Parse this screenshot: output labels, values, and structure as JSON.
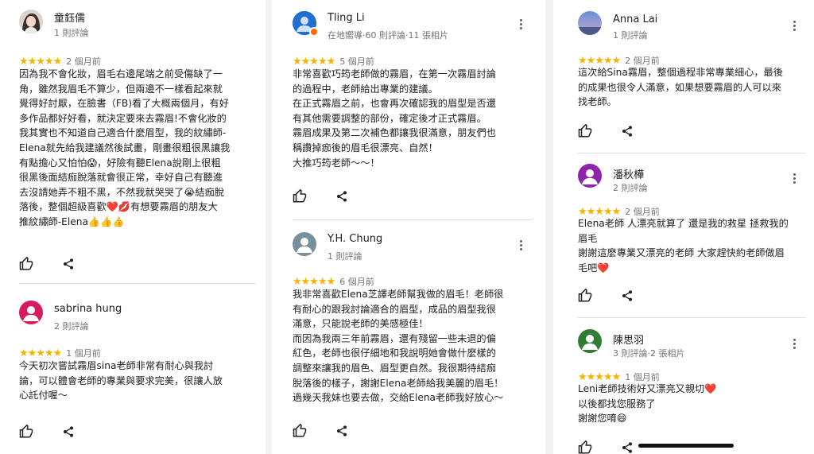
{
  "columns": [
    {
      "reviews": [
        {
          "name": "童鈺儒",
          "meta": "1 則評論",
          "stars": "★★★★★",
          "when": "2 個月前",
          "text": "因為我不會化妝，眉毛右邊尾端之前受傷缺了一\n角，雖然我眉毛不算少，但兩邊不一樣看起來就\n覺得好討厭，在臉書（FB)看了大概兩個月，有好\n多作品都好好看，就決定要來去霧眉!不會化妝的\n我其實也不知道自己適合什麼眉型，我的紋繡師-\nElena就先給我建議然後試畫，剛畫很粗很黑讓我\n有點擔心又怕怕😱，好險有聽Elena說剛上很粗\n很黑後面結痂脫落就會很正常，幸好自己有聽進\n去沒請她弄不粗不黑，不然我就哭哭了😭結痂脫\n落後，整個超級喜歡❤️💋有想要霧眉的朋友大\n推紋繡師-Elena👍👍👍"
        },
        {
          "name": "sabrina hung",
          "meta": "2 則評論",
          "stars": "★★★★★",
          "when": "1 個月前",
          "text": "今天初次嘗試霧眉sina老師非常有耐心與我討\n論，可以體會老師的專業與要求完美，很讓人放\n心託付喔～"
        }
      ]
    },
    {
      "reviews": [
        {
          "name": "Tling Li",
          "meta": "在地嚮導·60 則評論·11 張相片",
          "stars": "★★★★★",
          "when": "5 個月前",
          "text": "非常喜歡巧筠老師做的霧眉，在第一次霧眉討論\n的過程中，老師給出專業的建議。\n在正式霧眉之前，也會再次確認我的眉型是否還\n有其他需要調整的部份，確定後才正式霧眉。\n霧眉成果及第二次補色都讓我很滿意，朋友們也\n稱讚掉痂後的眉毛很漂亮、自然！\n大推巧筠老師～～！"
        },
        {
          "name": "Y.H. Chung",
          "meta": "1 則評論",
          "stars": "★★★★★",
          "when": "6 個月前",
          "text": "我非常喜歡Elena芝譯老師幫我做的眉毛！老師很\n有耐心的跟我討論適合的眉型，成品的眉型我很\n滿意，只能說老師的美感極佳！\n而因為我兩三年前霧眉，還有殘留一些未退的偏\n紅色，老師也很仔細地和我說明她會做什麼樣的\n調整來讓我的眉色、眉型更自然。我很期待結痂\n脫落後的樣子，謝謝Elena老師給我美麗的眉毛！\n過幾天我妹也要去做，交給Elena老師我好放心～"
        }
      ]
    },
    {
      "reviews": [
        {
          "name": "Anna Lai",
          "meta": "1 則評論",
          "stars": "★★★★★",
          "when": "2 個月前",
          "text": "這次給Sina霧眉，整個過程非常專業細心，最後\n的成果也很令人滿意，如果想要霧眉的人可以來\n找老師。"
        },
        {
          "name": "潘秋樺",
          "meta": "2 則評論",
          "stars": "★★★★★",
          "when": "2 個月前",
          "text": "Elena老師 人漂亮就算了 還是我的救星 拯救我的\n眉毛\n謝謝這麼專業又漂亮的老師 大家趕快約老師做眉\n毛吧❤️"
        },
        {
          "name": "陳思羽",
          "meta": "3 則評論·2 張相片",
          "stars": "★★★★★",
          "when": "1 個月前",
          "text": "Leni老師技術好又漂亮又親切❤️\n以後都找您服務了\n謝謝您唷😄"
        }
      ]
    }
  ],
  "colors": {
    "star": "#f4b400",
    "text": "#202124",
    "meta": "#70757a",
    "divider": "#e0e0e0",
    "avatar_sabrina": "#d81b60",
    "avatar_pan": "#8e24aa",
    "avatar_chen": "#2e7d32",
    "avatar_tling": "#1565c0",
    "avatar_yh": "#78909c",
    "avatar_anna": "#5c6bc0"
  },
  "icons": [
    "thumb-up-icon",
    "share-icon",
    "more-vert-icon",
    "person-icon",
    "local-guide-badge-icon"
  ]
}
